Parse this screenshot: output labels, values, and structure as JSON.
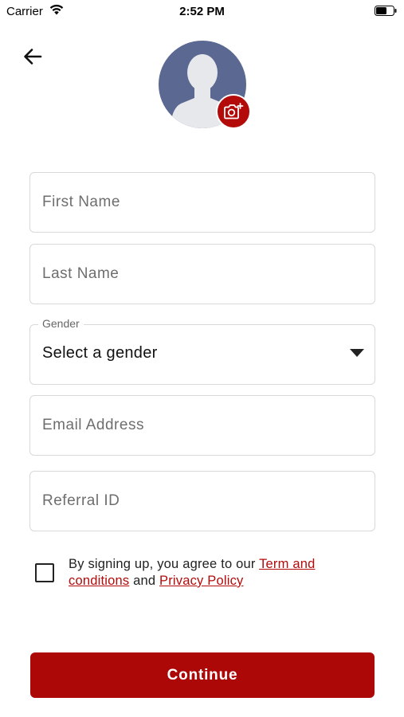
{
  "status_bar": {
    "carrier": "Carrier",
    "time": "2:52 PM",
    "wifi_icon": "wifi-icon",
    "battery_icon": "battery-icon"
  },
  "header": {
    "back_icon": "arrow-left-icon",
    "avatar_icon": "user-silhouette-icon",
    "camera_icon": "camera-add-icon",
    "accent_color": "#b30a0a"
  },
  "form": {
    "first_name": {
      "placeholder": "First Name",
      "value": ""
    },
    "last_name": {
      "placeholder": "Last Name",
      "value": ""
    },
    "gender": {
      "label": "Gender",
      "selected": "Select a gender"
    },
    "email": {
      "placeholder": "Email Address",
      "value": ""
    },
    "referral": {
      "placeholder": "Referral ID",
      "value": ""
    }
  },
  "terms": {
    "checked": false,
    "prefix": "By signing up, you agree to our ",
    "terms_link": "Term and conditions",
    "joiner": " and ",
    "privacy_link": "Privacy Policy"
  },
  "actions": {
    "continue_label": "Continue",
    "button_color": "#ad0808"
  }
}
